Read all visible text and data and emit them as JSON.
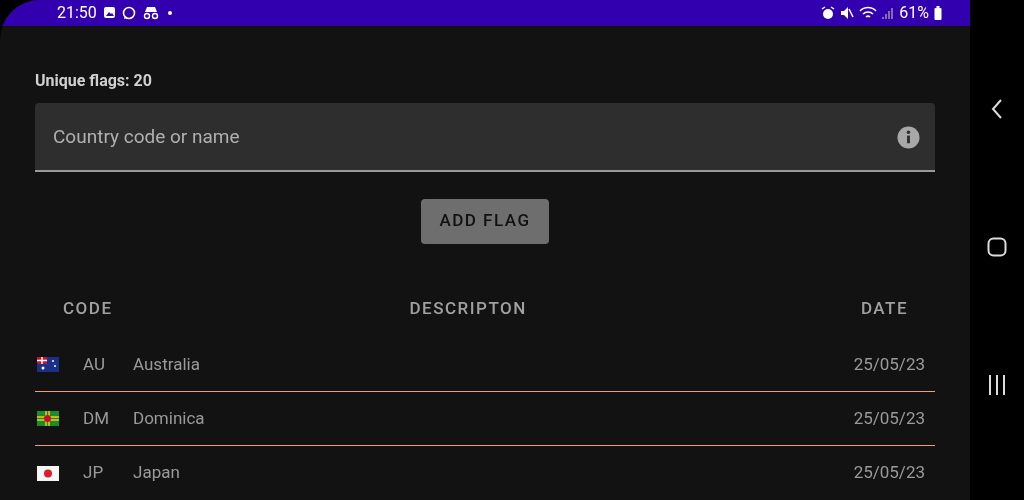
{
  "status_bar": {
    "time": "21:50",
    "battery": "61%"
  },
  "unique_flags": "Unique flags: 20",
  "search": {
    "placeholder": "Country code or name"
  },
  "add_button": "ADD FLAG",
  "table": {
    "columns": [
      "CODE",
      "DESCRIPTON",
      "DATE"
    ],
    "rows": [
      {
        "kind": "au",
        "code": "AU",
        "description": "Australia",
        "date": "25/05/23"
      },
      {
        "kind": "dm",
        "code": "DM",
        "description": "Dominica",
        "date": "25/05/23"
      },
      {
        "kind": "jp",
        "code": "JP",
        "description": "Japan",
        "date": "25/05/23"
      }
    ]
  }
}
